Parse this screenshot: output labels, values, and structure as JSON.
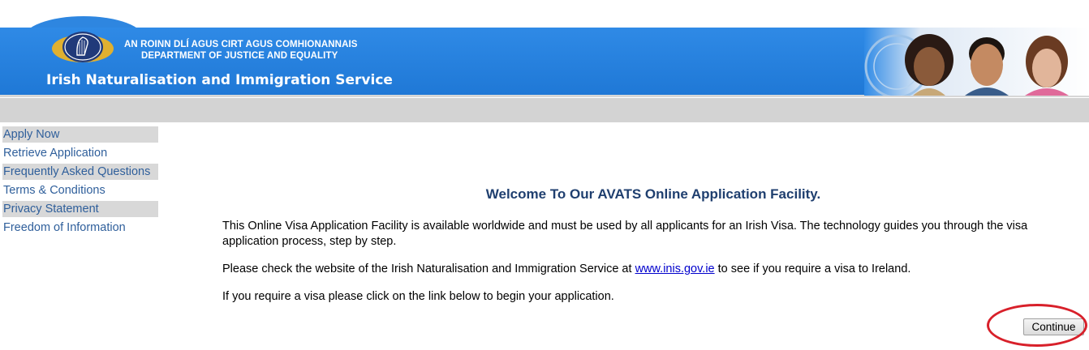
{
  "header": {
    "dept_line_1": "AN ROINN DLÍ AGUS CIRT AGUS COMHIONANNAIS",
    "dept_line_2": "DEPARTMENT OF JUSTICE AND EQUALITY",
    "service_title": "Irish Naturalisation and Immigration Service",
    "crest_icon": "harp-crest-icon",
    "people_image": "header-people-photo",
    "colors": {
      "banner_blue": "#2f8ae6",
      "crest_gold": "#e0b030",
      "crest_navy": "#213a7a"
    }
  },
  "sidebar": {
    "items": [
      {
        "label": "Apply Now",
        "shaded": true
      },
      {
        "label": "Retrieve Application",
        "shaded": false
      },
      {
        "label": "Frequently Asked Questions",
        "shaded": true
      },
      {
        "label": "Terms & Conditions",
        "shaded": false
      },
      {
        "label": "Privacy Statement",
        "shaded": true
      },
      {
        "label": "Freedom of Information",
        "shaded": false
      }
    ]
  },
  "main": {
    "heading": "Welcome To Our AVATS Online Application Facility.",
    "paragraph_1": "This Online Visa Application Facility is available worldwide and must be used by all applicants for an Irish Visa. The technology guides you through the visa application process, step by step.",
    "paragraph_2_before": "Please check the website of the Irish Naturalisation and Immigration Service at ",
    "paragraph_2_link": "www.inis.gov.ie",
    "paragraph_2_after": " to see if you require a visa to Ireland.",
    "paragraph_3": "If you require a visa please click on the link below to begin your application.",
    "continue_label": "Continue",
    "highlight_color": "#d8202a"
  }
}
